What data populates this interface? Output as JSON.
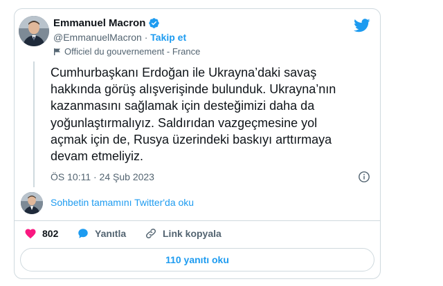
{
  "author": {
    "name": "Emmanuel Macron",
    "handle": "@EmmanuelMacron",
    "separator": " · ",
    "follow_label": "Takip et",
    "affiliation": "Officiel du gouvernement - France"
  },
  "tweet": {
    "text": "Cumhurbaşkanı Erdoğan ile Ukrayna’daki savaş\nhakkında görüş alışverişinde bulunduk. Ukrayna’nın\nkazanmasını sağlamak için desteğimizi daha da\nyoğunlaştırmalıyız. Saldırıdan vazgeçmesine yol\naçmak için de, Rusya üzerindeki baskıyı arttırmaya\ndevam etmeliyiz.",
    "timestamp": "ÖS 10:11 · 24 Şub 2023"
  },
  "conversation_link": "Sohbetin tamamını Twitter'da oku",
  "actions": {
    "like_count": "802",
    "reply_label": "Yanıtla",
    "copy_link_label": "Link kopyala"
  },
  "read_replies_label": "110 yanıtı oku",
  "colors": {
    "accent": "#1d9bf0",
    "like": "#f91880",
    "border": "#cfd9de",
    "muted": "#536471"
  },
  "icons": [
    "verified-badge-icon",
    "twitter-bird-icon",
    "government-flag-icon",
    "info-icon",
    "heart-icon",
    "reply-bubble-icon",
    "link-icon"
  ]
}
